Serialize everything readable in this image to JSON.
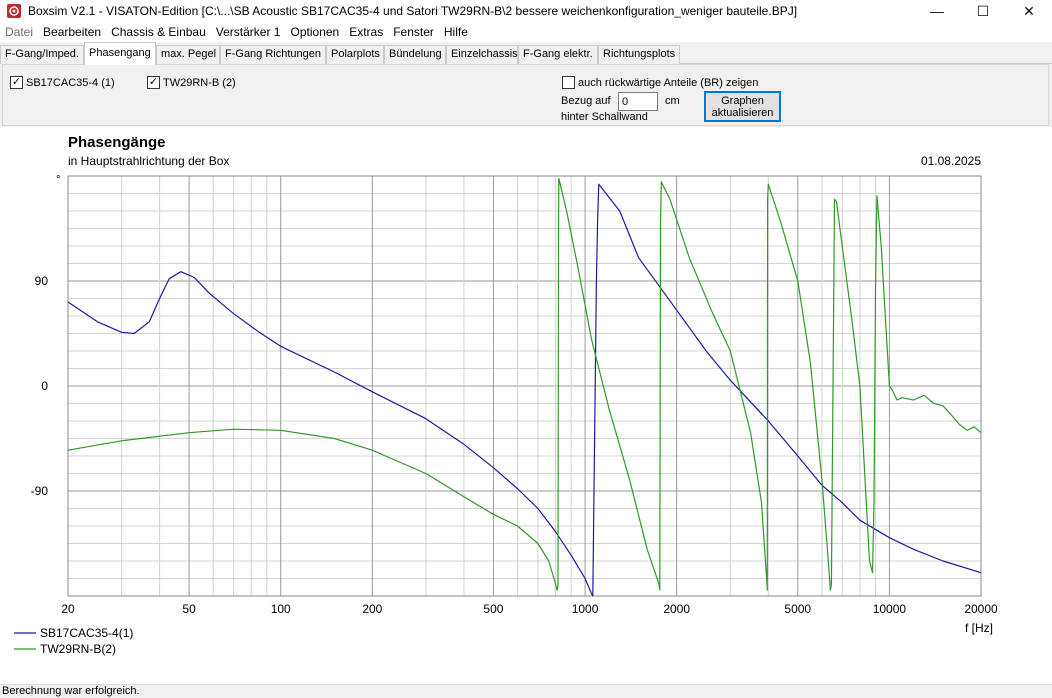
{
  "window": {
    "title": "Boxsim V2.1 - VISATON-Edition [C:\\...\\SB Acoustic SB17CAC35-4 und Satori TW29RN-B\\2 bessere weichenkonfiguration_weniger bauteile.BPJ]",
    "icon": "boxsim-app-icon",
    "minimize": "—",
    "maximize": "☐",
    "close": "✕"
  },
  "menu": [
    "Datei",
    "Bearbeiten",
    "Chassis & Einbau",
    "Verstärker 1",
    "Optionen",
    "Extras",
    "Fenster",
    "Hilfe"
  ],
  "tabs": [
    "F-Gang/Imped.",
    "Phasengang",
    "max. Pegel",
    "F-Gang Richtungen",
    "Polarplots",
    "Bündelung",
    "Einzelchassis",
    "F-Gang elektr.",
    "Richtungsplots"
  ],
  "active_tab": "Phasengang",
  "options": {
    "chassis1": {
      "label": "SB17CAC35-4 (1)",
      "checked": true
    },
    "chassis2": {
      "label": "TW29RN-B (2)",
      "checked": true
    },
    "br_label": "auch rückwärtige Anteile (BR) zeigen",
    "br_checked": false,
    "bezug_label": "Bezug auf",
    "bezug_value": "0",
    "bezug_unit": "cm",
    "bezug_sub": "hinter Schallwand",
    "update_line1": "Graphen",
    "update_line2": "aktualisieren",
    "check_glyph": "✓"
  },
  "status": "Berechnung war erfolgreich.",
  "chart_data": {
    "type": "line",
    "title": "Phasengänge",
    "subtitle": "in Hauptstrahlrichtung der Box",
    "date": "01.08.2025",
    "xlabel": "f [Hz]",
    "ylabel": "°",
    "xscale": "log",
    "xlim": [
      20,
      20000
    ],
    "ylim": [
      -180,
      180
    ],
    "x_ticks": [
      20,
      50,
      100,
      200,
      500,
      1000,
      2000,
      5000,
      10000,
      20000
    ],
    "y_ticks": [
      90,
      0,
      -90
    ],
    "grid": true,
    "legend_position": "bottom-left",
    "series": [
      {
        "name": "SB17CAC35-4(1)",
        "color": "#1a1aa6",
        "points": [
          [
            20,
            72
          ],
          [
            25,
            55
          ],
          [
            30,
            46
          ],
          [
            33,
            45
          ],
          [
            37,
            55
          ],
          [
            40,
            75
          ],
          [
            43,
            92
          ],
          [
            47,
            98
          ],
          [
            52,
            93
          ],
          [
            58,
            80
          ],
          [
            70,
            62
          ],
          [
            85,
            46
          ],
          [
            100,
            34
          ],
          [
            150,
            12
          ],
          [
            200,
            -5
          ],
          [
            300,
            -28
          ],
          [
            400,
            -50
          ],
          [
            500,
            -70
          ],
          [
            600,
            -88
          ],
          [
            700,
            -105
          ],
          [
            800,
            -125
          ],
          [
            900,
            -145
          ],
          [
            1000,
            -165
          ],
          [
            1050,
            -178
          ],
          [
            1060,
            -180
          ],
          [
            1090,
            90
          ],
          [
            1100,
            145
          ],
          [
            1110,
            173
          ],
          [
            1300,
            150
          ],
          [
            1500,
            110
          ],
          [
            2000,
            65
          ],
          [
            2500,
            30
          ],
          [
            3000,
            5
          ],
          [
            4000,
            -30
          ],
          [
            5000,
            -60
          ],
          [
            6000,
            -85
          ],
          [
            7000,
            -100
          ],
          [
            8000,
            -115
          ],
          [
            10000,
            -130
          ],
          [
            12000,
            -140
          ],
          [
            15000,
            -150
          ],
          [
            20000,
            -160
          ]
        ]
      },
      {
        "name": "TW29RN-B(2)",
        "color": "#2f9a28",
        "points": [
          [
            20,
            -55
          ],
          [
            30,
            -47
          ],
          [
            50,
            -40
          ],
          [
            70,
            -37
          ],
          [
            100,
            -38
          ],
          [
            150,
            -45
          ],
          [
            200,
            -55
          ],
          [
            300,
            -75
          ],
          [
            400,
            -95
          ],
          [
            500,
            -110
          ],
          [
            600,
            -120
          ],
          [
            700,
            -135
          ],
          [
            760,
            -150
          ],
          [
            800,
            -170
          ],
          [
            810,
            -175
          ],
          [
            815,
            -170
          ],
          [
            818,
            120
          ],
          [
            820,
            178
          ],
          [
            870,
            150
          ],
          [
            950,
            100
          ],
          [
            1050,
            40
          ],
          [
            1200,
            -20
          ],
          [
            1400,
            -80
          ],
          [
            1600,
            -140
          ],
          [
            1750,
            -170
          ],
          [
            1760,
            -175
          ],
          [
            1770,
            140
          ],
          [
            1780,
            175
          ],
          [
            1900,
            160
          ],
          [
            2200,
            110
          ],
          [
            2600,
            65
          ],
          [
            3000,
            30
          ],
          [
            3500,
            -40
          ],
          [
            3800,
            -100
          ],
          [
            3960,
            -170
          ],
          [
            3970,
            -175
          ],
          [
            3980,
            160
          ],
          [
            4000,
            173
          ],
          [
            4400,
            140
          ],
          [
            5000,
            90
          ],
          [
            5500,
            20
          ],
          [
            6000,
            -80
          ],
          [
            6300,
            -150
          ],
          [
            6400,
            -175
          ],
          [
            6450,
            -170
          ],
          [
            6600,
            160
          ],
          [
            6700,
            158
          ],
          [
            7000,
            120
          ],
          [
            7500,
            60
          ],
          [
            8000,
            0
          ],
          [
            8400,
            -100
          ],
          [
            8600,
            -150
          ],
          [
            8800,
            -160
          ],
          [
            8900,
            -100
          ],
          [
            9000,
            80
          ],
          [
            9100,
            163
          ],
          [
            9400,
            120
          ],
          [
            10000,
            0
          ],
          [
            10200,
            -3
          ],
          [
            10600,
            -12
          ],
          [
            11000,
            -10
          ],
          [
            12000,
            -12
          ],
          [
            13000,
            -8
          ],
          [
            14000,
            -15
          ],
          [
            15000,
            -17
          ],
          [
            16000,
            -25
          ],
          [
            17000,
            -33
          ],
          [
            18000,
            -38
          ],
          [
            19000,
            -35
          ],
          [
            20000,
            -40
          ]
        ]
      }
    ]
  }
}
